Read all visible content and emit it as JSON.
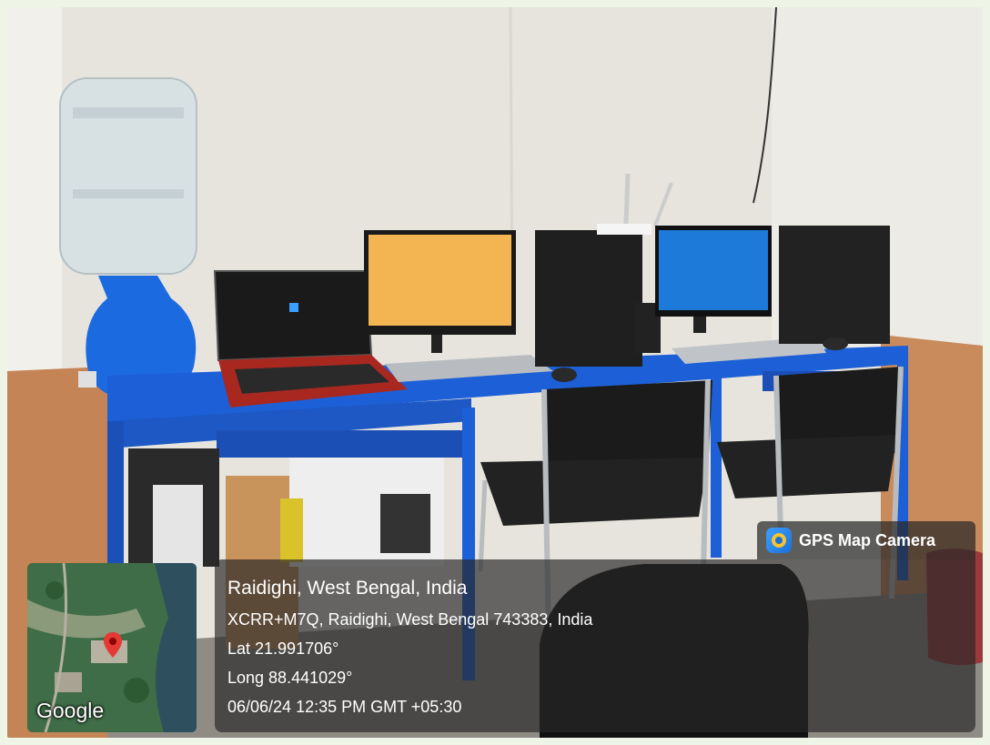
{
  "camera_app": {
    "name": "GPS Map Camera",
    "icon": "camera-pin-icon"
  },
  "location": {
    "title": "Raidighi, West Bengal, India",
    "address": "XCRR+M7Q, Raidighi, West Bengal 743383, India",
    "lat": "Lat 21.991706°",
    "long": "Long 88.441029°",
    "datetime": "06/06/24 12:35 PM GMT +05:30"
  },
  "map": {
    "provider": "Google",
    "marker_icon": "map-pin-icon"
  },
  "colors": {
    "desk_blue": "#1c5fd6",
    "wall": "#e8e6df",
    "wall_lower": "#c98a5c",
    "overlay": "#282828"
  }
}
